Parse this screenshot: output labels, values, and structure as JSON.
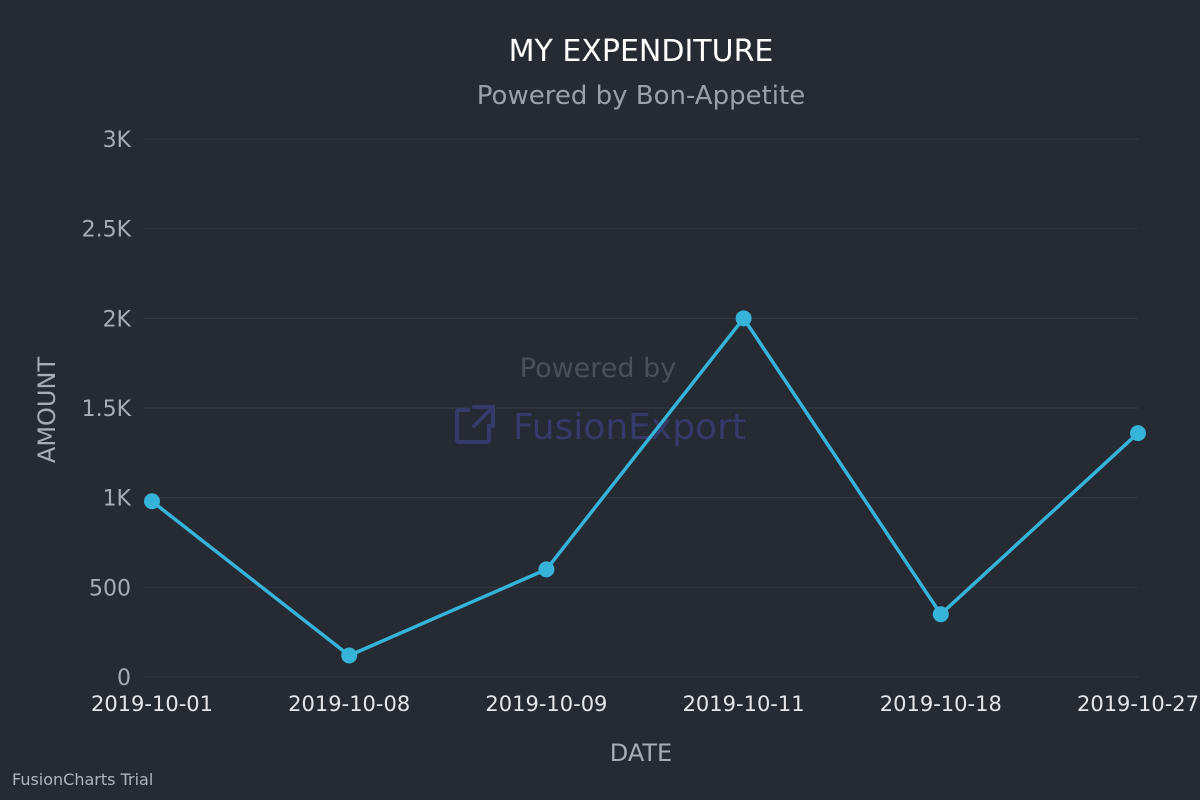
{
  "chart_data": {
    "type": "line",
    "title": "MY EXPENDITURE",
    "subtitle": "Powered by Bon-Appetite",
    "xlabel": "DATE",
    "ylabel": "AMOUNT",
    "categories": [
      "2019-10-01",
      "2019-10-08",
      "2019-10-09",
      "2019-10-11",
      "2019-10-18",
      "2019-10-27"
    ],
    "values": [
      980,
      120,
      600,
      2000,
      350,
      1360
    ],
    "ylim": [
      0,
      3000
    ],
    "yticks": [
      0,
      500,
      1000,
      1500,
      2000,
      2500,
      3000
    ],
    "ytick_labels": [
      "0",
      "500",
      "1K",
      "1.5K",
      "2K",
      "2.5K",
      "3K"
    ],
    "grid": true,
    "series_color": "#36b3d9",
    "background_color": "#262a33"
  },
  "watermark": {
    "line1": "Powered by",
    "line2": "FusionExport",
    "icon": "external-link-icon"
  },
  "footer": {
    "trial_text": "FusionCharts Trial"
  }
}
